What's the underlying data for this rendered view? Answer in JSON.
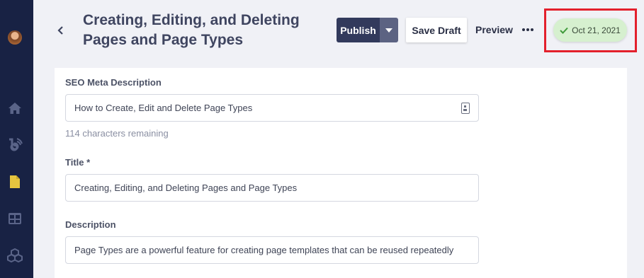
{
  "header": {
    "title_line1": "Creating, Editing, and Deleting",
    "title_line2": "Pages and Page Types",
    "publish_label": "Publish",
    "save_draft_label": "Save Draft",
    "preview_label": "Preview",
    "status_date": "Oct 21, 2021",
    "status_color": "#d6f0cf"
  },
  "sidebar": {
    "items": [
      {
        "icon": "home-icon"
      },
      {
        "icon": "blog-icon"
      },
      {
        "icon": "page-icon",
        "active_color": "#e6c53f"
      },
      {
        "icon": "table-icon"
      },
      {
        "icon": "modules-icon"
      }
    ]
  },
  "form": {
    "seo": {
      "label": "SEO Meta Description",
      "value": "How to Create, Edit and Delete Page Types",
      "hint": "114 characters remaining"
    },
    "title": {
      "label": "Title *",
      "value": "Creating, Editing, and Deleting Pages and Page Types"
    },
    "description": {
      "label": "Description",
      "value": "Page Types are a powerful feature for creating page templates that can be reused repeatedly"
    }
  }
}
